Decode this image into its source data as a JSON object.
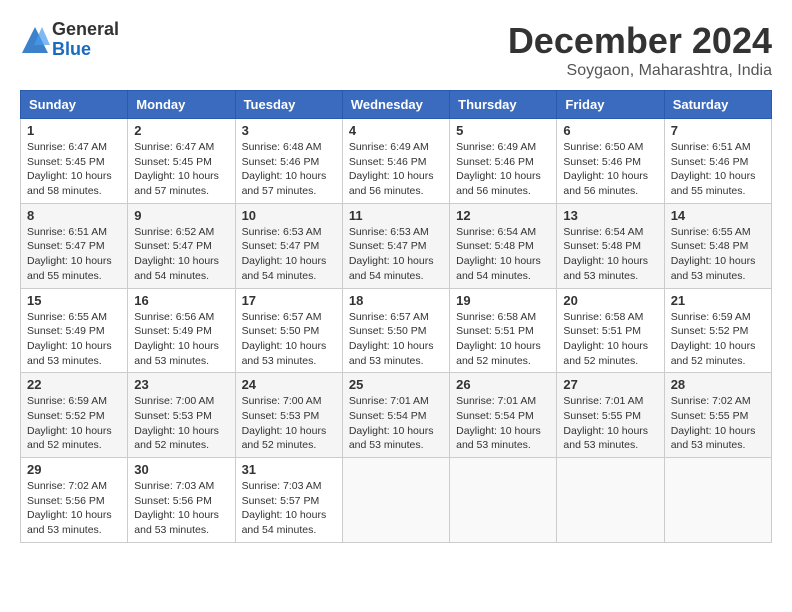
{
  "logo": {
    "general": "General",
    "blue": "Blue"
  },
  "title": "December 2024",
  "subtitle": "Soygaon, Maharashtra, India",
  "days_of_week": [
    "Sunday",
    "Monday",
    "Tuesday",
    "Wednesday",
    "Thursday",
    "Friday",
    "Saturday"
  ],
  "weeks": [
    [
      {
        "day": "1",
        "info": "Sunrise: 6:47 AM\nSunset: 5:45 PM\nDaylight: 10 hours\nand 58 minutes."
      },
      {
        "day": "2",
        "info": "Sunrise: 6:47 AM\nSunset: 5:45 PM\nDaylight: 10 hours\nand 57 minutes."
      },
      {
        "day": "3",
        "info": "Sunrise: 6:48 AM\nSunset: 5:46 PM\nDaylight: 10 hours\nand 57 minutes."
      },
      {
        "day": "4",
        "info": "Sunrise: 6:49 AM\nSunset: 5:46 PM\nDaylight: 10 hours\nand 56 minutes."
      },
      {
        "day": "5",
        "info": "Sunrise: 6:49 AM\nSunset: 5:46 PM\nDaylight: 10 hours\nand 56 minutes."
      },
      {
        "day": "6",
        "info": "Sunrise: 6:50 AM\nSunset: 5:46 PM\nDaylight: 10 hours\nand 56 minutes."
      },
      {
        "day": "7",
        "info": "Sunrise: 6:51 AM\nSunset: 5:46 PM\nDaylight: 10 hours\nand 55 minutes."
      }
    ],
    [
      {
        "day": "8",
        "info": "Sunrise: 6:51 AM\nSunset: 5:47 PM\nDaylight: 10 hours\nand 55 minutes."
      },
      {
        "day": "9",
        "info": "Sunrise: 6:52 AM\nSunset: 5:47 PM\nDaylight: 10 hours\nand 54 minutes."
      },
      {
        "day": "10",
        "info": "Sunrise: 6:53 AM\nSunset: 5:47 PM\nDaylight: 10 hours\nand 54 minutes."
      },
      {
        "day": "11",
        "info": "Sunrise: 6:53 AM\nSunset: 5:47 PM\nDaylight: 10 hours\nand 54 minutes."
      },
      {
        "day": "12",
        "info": "Sunrise: 6:54 AM\nSunset: 5:48 PM\nDaylight: 10 hours\nand 54 minutes."
      },
      {
        "day": "13",
        "info": "Sunrise: 6:54 AM\nSunset: 5:48 PM\nDaylight: 10 hours\nand 53 minutes."
      },
      {
        "day": "14",
        "info": "Sunrise: 6:55 AM\nSunset: 5:48 PM\nDaylight: 10 hours\nand 53 minutes."
      }
    ],
    [
      {
        "day": "15",
        "info": "Sunrise: 6:55 AM\nSunset: 5:49 PM\nDaylight: 10 hours\nand 53 minutes."
      },
      {
        "day": "16",
        "info": "Sunrise: 6:56 AM\nSunset: 5:49 PM\nDaylight: 10 hours\nand 53 minutes."
      },
      {
        "day": "17",
        "info": "Sunrise: 6:57 AM\nSunset: 5:50 PM\nDaylight: 10 hours\nand 53 minutes."
      },
      {
        "day": "18",
        "info": "Sunrise: 6:57 AM\nSunset: 5:50 PM\nDaylight: 10 hours\nand 53 minutes."
      },
      {
        "day": "19",
        "info": "Sunrise: 6:58 AM\nSunset: 5:51 PM\nDaylight: 10 hours\nand 52 minutes."
      },
      {
        "day": "20",
        "info": "Sunrise: 6:58 AM\nSunset: 5:51 PM\nDaylight: 10 hours\nand 52 minutes."
      },
      {
        "day": "21",
        "info": "Sunrise: 6:59 AM\nSunset: 5:52 PM\nDaylight: 10 hours\nand 52 minutes."
      }
    ],
    [
      {
        "day": "22",
        "info": "Sunrise: 6:59 AM\nSunset: 5:52 PM\nDaylight: 10 hours\nand 52 minutes."
      },
      {
        "day": "23",
        "info": "Sunrise: 7:00 AM\nSunset: 5:53 PM\nDaylight: 10 hours\nand 52 minutes."
      },
      {
        "day": "24",
        "info": "Sunrise: 7:00 AM\nSunset: 5:53 PM\nDaylight: 10 hours\nand 52 minutes."
      },
      {
        "day": "25",
        "info": "Sunrise: 7:01 AM\nSunset: 5:54 PM\nDaylight: 10 hours\nand 53 minutes."
      },
      {
        "day": "26",
        "info": "Sunrise: 7:01 AM\nSunset: 5:54 PM\nDaylight: 10 hours\nand 53 minutes."
      },
      {
        "day": "27",
        "info": "Sunrise: 7:01 AM\nSunset: 5:55 PM\nDaylight: 10 hours\nand 53 minutes."
      },
      {
        "day": "28",
        "info": "Sunrise: 7:02 AM\nSunset: 5:55 PM\nDaylight: 10 hours\nand 53 minutes."
      }
    ],
    [
      {
        "day": "29",
        "info": "Sunrise: 7:02 AM\nSunset: 5:56 PM\nDaylight: 10 hours\nand 53 minutes."
      },
      {
        "day": "30",
        "info": "Sunrise: 7:03 AM\nSunset: 5:56 PM\nDaylight: 10 hours\nand 53 minutes."
      },
      {
        "day": "31",
        "info": "Sunrise: 7:03 AM\nSunset: 5:57 PM\nDaylight: 10 hours\nand 54 minutes."
      },
      {
        "day": "",
        "info": ""
      },
      {
        "day": "",
        "info": ""
      },
      {
        "day": "",
        "info": ""
      },
      {
        "day": "",
        "info": ""
      }
    ]
  ]
}
